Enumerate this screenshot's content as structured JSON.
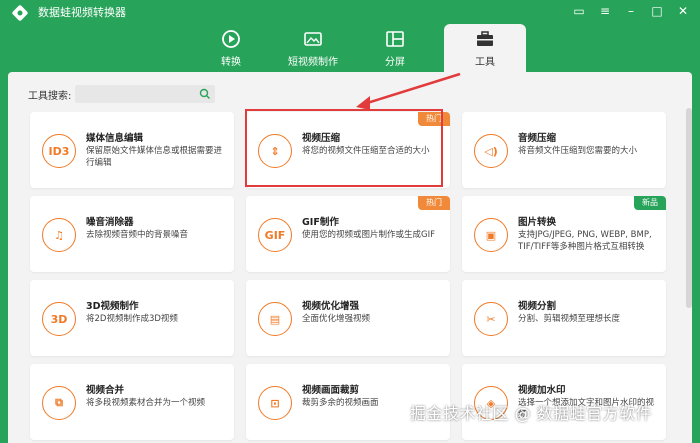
{
  "app": {
    "title": "数据蛙视频转换器"
  },
  "tabs": [
    {
      "label": "转换",
      "icon": "convert-icon"
    },
    {
      "label": "短视频制作",
      "icon": "short-video-icon"
    },
    {
      "label": "分屏",
      "icon": "split-screen-icon"
    },
    {
      "label": "工具",
      "icon": "toolbox-icon",
      "active": true
    }
  ],
  "search": {
    "label": "工具搜索:",
    "placeholder": ""
  },
  "cards": [
    {
      "title": "媒体信息编辑",
      "desc": "保留原始文件媒体信息或根据需要进行编辑",
      "icon_text": "ID3",
      "badge": ""
    },
    {
      "title": "视频压缩",
      "desc": "将您的视频文件压缩至合适的大小",
      "icon_text": "⇕",
      "badge": "热门"
    },
    {
      "title": "音频压缩",
      "desc": "将音频文件压缩到您需要的大小",
      "icon_text": "◁)",
      "badge": ""
    },
    {
      "title": "噪音消除器",
      "desc": "去除视频音频中的背景噪音",
      "icon_text": "♫",
      "badge": ""
    },
    {
      "title": "GIF制作",
      "desc": "使用您的视频或图片制作或生成GIF",
      "icon_text": "GIF",
      "badge": "热门"
    },
    {
      "title": "图片转换",
      "desc": "支持JPG/JPEG, PNG, WEBP, BMP, TIF/TIFF等多种图片格式互相转换",
      "icon_text": "▣",
      "badge": "新品"
    },
    {
      "title": "3D视频制作",
      "desc": "将2D视频制作成3D视频",
      "icon_text": "3D",
      "badge": ""
    },
    {
      "title": "视频优化增强",
      "desc": "全面优化增强视频",
      "icon_text": "▤",
      "badge": ""
    },
    {
      "title": "视频分割",
      "desc": "分割、剪辑视频至理想长度",
      "icon_text": "✂",
      "badge": ""
    },
    {
      "title": "视频合并",
      "desc": "将多段视频素材合并为一个视频",
      "icon_text": "⧉",
      "badge": ""
    },
    {
      "title": "视频画面裁剪",
      "desc": "裁剪多余的视频画面",
      "icon_text": "⊡",
      "badge": ""
    },
    {
      "title": "视频加水印",
      "desc": "选择一个想添加文字和图片水印的视频",
      "icon_text": "◈",
      "badge": ""
    }
  ],
  "watermark": "掘金技术社区 @ 数据蛙官方软件",
  "colors": {
    "brand": "#27a35a",
    "accent": "#f07a27",
    "highlight": "#e23b3b"
  }
}
